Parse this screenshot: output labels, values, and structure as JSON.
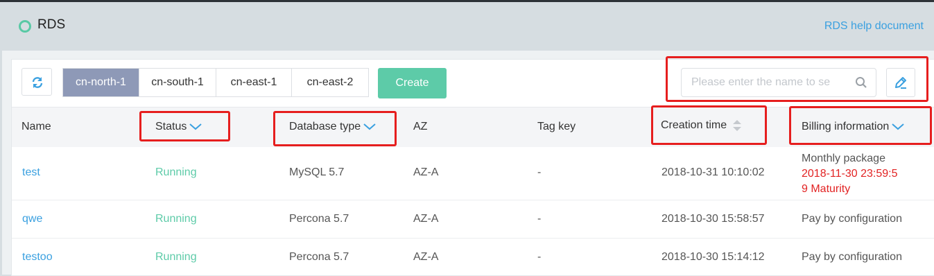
{
  "header": {
    "title": "RDS",
    "help_link": "RDS help document"
  },
  "toolbar": {
    "refresh_icon": "refresh-icon",
    "regions": [
      "cn-north-1",
      "cn-south-1",
      "cn-east-1",
      "cn-east-2"
    ],
    "active_region": "cn-north-1",
    "create_label": "Create",
    "search_placeholder": "Please enter the name to se",
    "search_icon": "search-icon",
    "edit_icon": "edit-icon"
  },
  "table": {
    "columns": {
      "name": "Name",
      "status": "Status",
      "db_type": "Database type",
      "az": "AZ",
      "tag_key": "Tag key",
      "creation_time": "Creation time",
      "billing": "Billing information"
    },
    "rows": [
      {
        "name": "test",
        "status": "Running",
        "db_type": "MySQL 5.7",
        "az": "AZ-A",
        "tag_key": "-",
        "creation_time": "2018-10-31 10:10:02",
        "billing": "Monthly package",
        "billing_expiry_1": "2018-11-30 23:59:5",
        "billing_expiry_2": "9 Maturity"
      },
      {
        "name": "qwe",
        "status": "Running",
        "db_type": "Percona 5.7",
        "az": "AZ-A",
        "tag_key": "-",
        "creation_time": "2018-10-30 15:58:57",
        "billing": "Pay by configuration"
      },
      {
        "name": "testoo",
        "status": "Running",
        "db_type": "Percona 5.7",
        "az": "AZ-A",
        "tag_key": "-",
        "creation_time": "2018-10-30 15:14:12",
        "billing": "Pay by configuration"
      }
    ]
  },
  "colors": {
    "accent": "#5dcba8",
    "link": "#3aa0e0",
    "region_active": "#8e99b7",
    "expiry": "#e22323",
    "highlight_box": "#e61e1e"
  }
}
